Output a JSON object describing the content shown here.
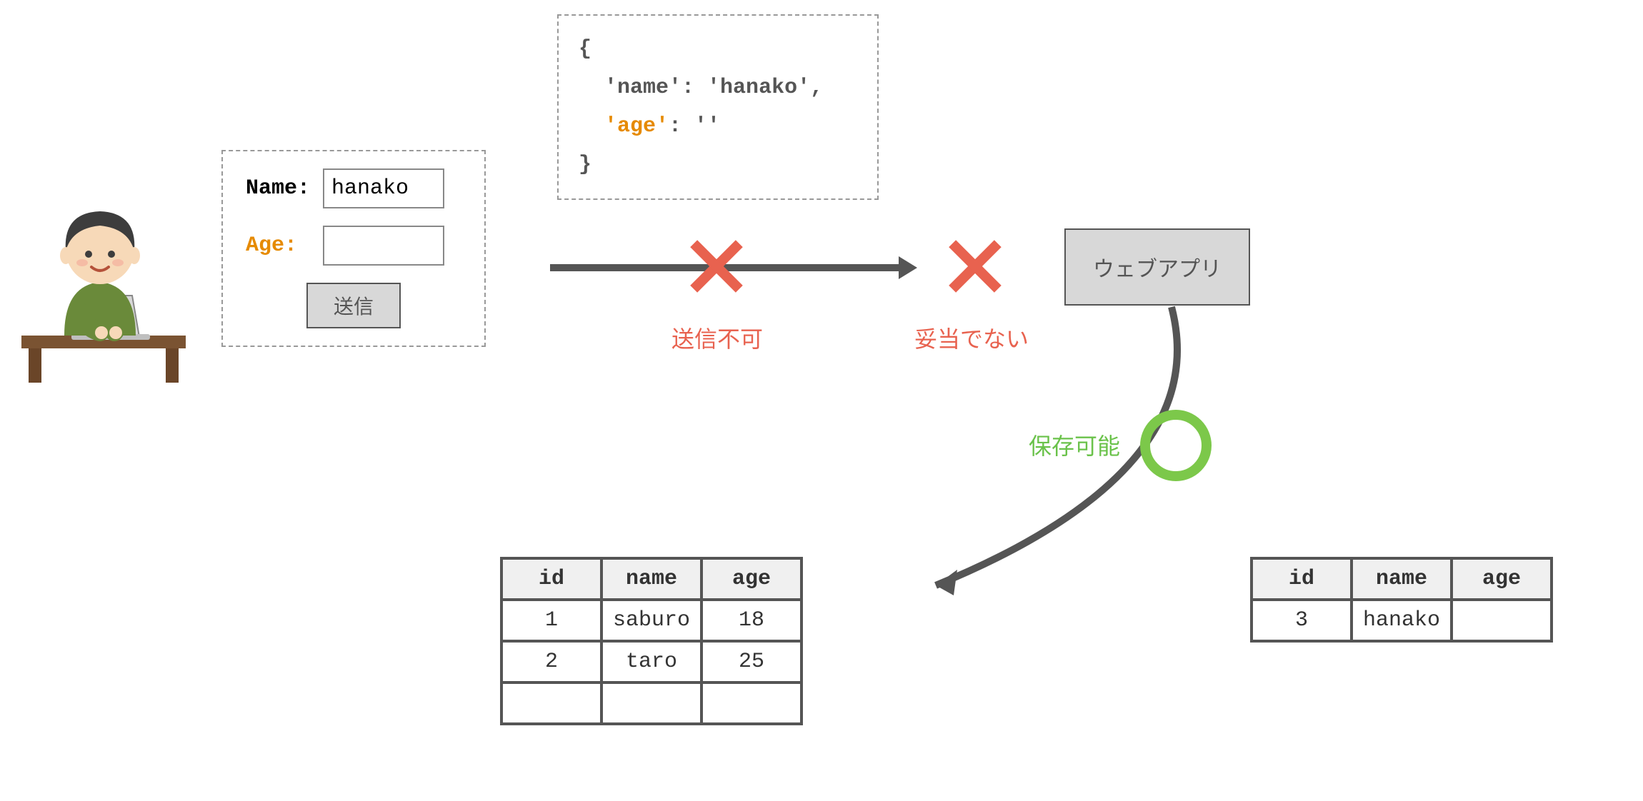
{
  "form": {
    "name_label": "Name:",
    "age_label": "Age:",
    "name_value": "hanako",
    "age_value": "",
    "submit_label": "送信"
  },
  "json_payload": {
    "line1": "{",
    "line2_key": "'name'",
    "line2_val": ": 'hanako',",
    "line3_key": "'age'",
    "line3_val": ": ''",
    "line4": "}"
  },
  "webapp": {
    "label": "ウェブアプリ"
  },
  "status": {
    "send_fail": "送信不可",
    "invalid": "妥当でない",
    "saveable": "保存可能"
  },
  "left_table": {
    "headers": {
      "id": "id",
      "name": "name",
      "age": "age"
    },
    "rows": [
      {
        "id": "1",
        "name": "saburo",
        "age": "18"
      },
      {
        "id": "2",
        "name": "taro",
        "age": "25"
      },
      {
        "id": "",
        "name": "",
        "age": ""
      }
    ]
  },
  "right_table": {
    "headers": {
      "id": "id",
      "name": "name",
      "age": "age"
    },
    "rows": [
      {
        "id": "3",
        "name": "hanako",
        "age": ""
      }
    ]
  },
  "colors": {
    "orange": "#e68a00",
    "red": "#e8624f",
    "green": "#7cc84a",
    "blue": "#2a7ed6",
    "gray": "#555"
  }
}
